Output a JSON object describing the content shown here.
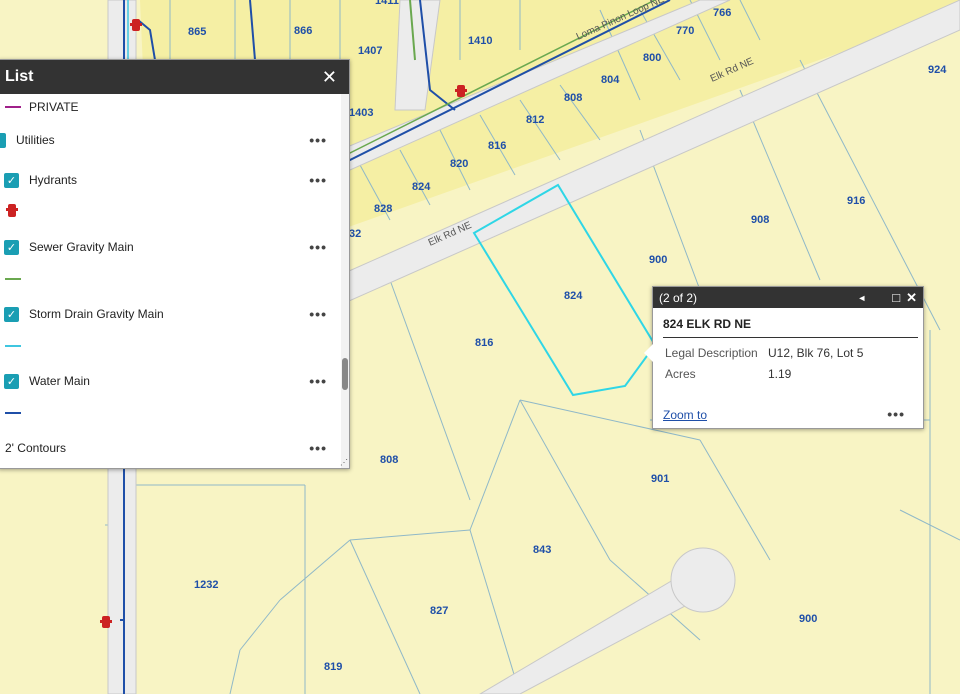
{
  "map": {
    "parcel_labels": [
      {
        "id": "865",
        "text": "865"
      },
      {
        "id": "866",
        "text": "866"
      },
      {
        "id": "1407",
        "text": "1407"
      },
      {
        "id": "1411",
        "text": "1411"
      },
      {
        "id": "1410",
        "text": "1410"
      },
      {
        "id": "766",
        "text": "766"
      },
      {
        "id": "770",
        "text": "770"
      },
      {
        "id": "800",
        "text": "800"
      },
      {
        "id": "804",
        "text": "804"
      },
      {
        "id": "808a",
        "text": "808"
      },
      {
        "id": "812",
        "text": "812"
      },
      {
        "id": "816a",
        "text": "816"
      },
      {
        "id": "820",
        "text": "820"
      },
      {
        "id": "824a",
        "text": "824"
      },
      {
        "id": "828",
        "text": "828"
      },
      {
        "id": "1403",
        "text": "1403"
      },
      {
        "id": "832",
        "text": "32"
      },
      {
        "id": "924",
        "text": "924"
      },
      {
        "id": "908",
        "text": "908"
      },
      {
        "id": "916",
        "text": "916"
      },
      {
        "id": "900a",
        "text": "900"
      },
      {
        "id": "824b",
        "text": "824"
      },
      {
        "id": "816b",
        "text": "816"
      },
      {
        "id": "808b",
        "text": "808"
      },
      {
        "id": "901",
        "text": "901"
      },
      {
        "id": "843",
        "text": "843"
      },
      {
        "id": "1232",
        "text": "1232"
      },
      {
        "id": "827",
        "text": "827"
      },
      {
        "id": "900b",
        "text": "900"
      },
      {
        "id": "819",
        "text": "819"
      }
    ],
    "road_labels": {
      "elk1": "Elk Rd NE",
      "elk2": "Elk Rd NE",
      "loma": "Loma Pinon Loop NE"
    },
    "colors": {
      "parcel": "#f8f4c4",
      "parcel_line": "#8fb8c8",
      "road": "#ececec",
      "road_edge": "#c8c8c8",
      "selected": "#2fd6e6",
      "water": "#1f4fa8",
      "sewer": "#6aa84f",
      "storm": "#3fc6e0",
      "hydrant": "#cc2222"
    }
  },
  "list_panel": {
    "title": "List",
    "close": "✕",
    "items": [
      {
        "label": "PRIVATE",
        "type": "legend",
        "swatch": "#a0208a"
      },
      {
        "label": "Utilities",
        "type": "group",
        "checked": true
      },
      {
        "label": "Hydrants",
        "type": "layer",
        "checked": true,
        "symbol": "hydrant-icon"
      },
      {
        "label": "Sewer Gravity Main",
        "type": "layer",
        "checked": true,
        "swatch": "#6aa84f"
      },
      {
        "label": "Storm Drain Gravity Main",
        "type": "layer",
        "checked": true,
        "swatch": "#3fc6e0"
      },
      {
        "label": "Water Main",
        "type": "layer",
        "checked": true,
        "swatch": "#1f4fa8"
      },
      {
        "label": "2' Contours",
        "type": "layer",
        "checked": false
      }
    ],
    "menu": "•••"
  },
  "popup": {
    "count": "(2 of 2)",
    "title": "824 ELK RD NE",
    "attributes": [
      {
        "name": "Legal Description",
        "value": "U12, Blk 76, Lot 5"
      },
      {
        "name": "Acres",
        "value": "1.19"
      }
    ],
    "zoom_label": "Zoom to",
    "menu": "•••",
    "prev": "◄",
    "maximize": "□",
    "close": "✕"
  }
}
